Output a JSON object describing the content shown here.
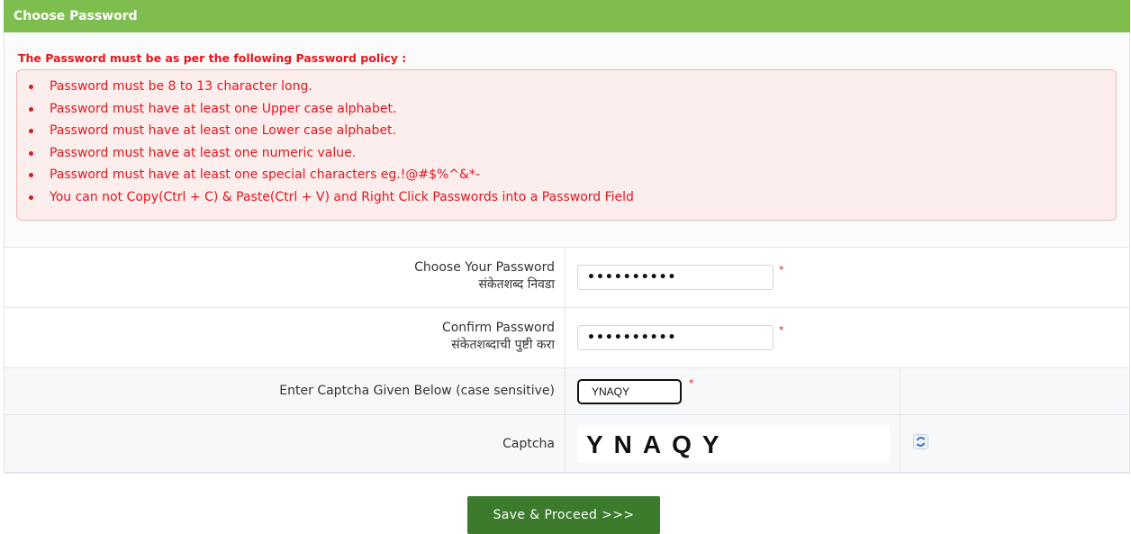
{
  "header": {
    "title": "Choose Password"
  },
  "policy": {
    "title": "The Password must be as per the following Password policy :",
    "items": [
      "Password must be 8 to 13 character long.",
      "Password must have at least one Upper case alphabet.",
      "Password must have at least one Lower case alphabet.",
      "Password must have at least one numeric value.",
      "Password must have at least one special characters eg.!@#$%^&*-",
      "You can not Copy(Ctrl + C) & Paste(Ctrl + V) and Right Click Passwords into a Password Field"
    ]
  },
  "form": {
    "password": {
      "label_en": "Choose Your Password",
      "label_mr": "संकेतशब्द निवडा",
      "value_masked": "••••••••••"
    },
    "confirm": {
      "label_en": "Confirm Password",
      "label_mr": "संकेतशब्दाची पुष्टी करा",
      "value_masked": "••••••••••"
    },
    "captcha_input": {
      "label": "Enter Captcha Given Below (case sensitive)",
      "value": "YNAQY"
    },
    "captcha": {
      "label": "Captcha",
      "image_text": "YNAQY"
    },
    "required_mark": "*"
  },
  "actions": {
    "save_label": "Save & Proceed >>>"
  },
  "colors": {
    "header": "#7dbe4f",
    "policy_text": "#e0181d",
    "save_button": "#3b7b2b"
  },
  "icons": {
    "refresh": "refresh-icon"
  }
}
